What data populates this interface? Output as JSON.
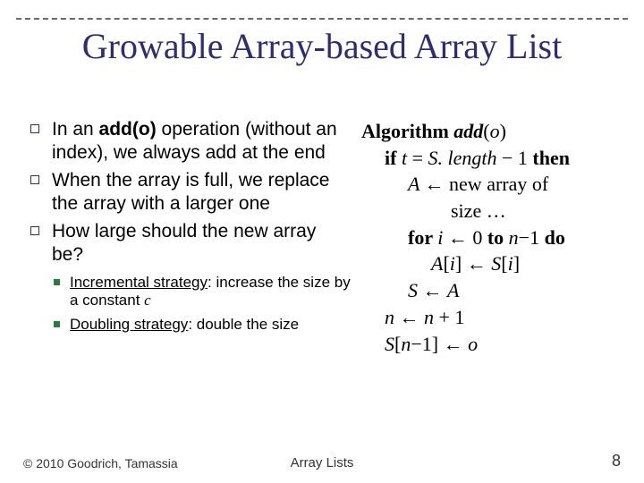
{
  "title": "Growable Array-based Array List",
  "bullets": {
    "b1_pre": "In an ",
    "b1_bold": "add(o)",
    "b1_post": " operation (without an index), we always add at the end",
    "b2": "When the array is full, we replace the array with a larger one",
    "b3": "How large should the new array be?",
    "s1_pre": "Incremental strategy",
    "s1_post": ": increase the size by a constant ",
    "s1_c": "c",
    "s2_pre": "Doubling strategy",
    "s2_post": ": double the size"
  },
  "algo": {
    "l0_kw": "Algorithm ",
    "l0_name_a": "add",
    "l0_name_b": "(",
    "l0_name_c": "o",
    "l0_name_d": ")",
    "l1_if": "if ",
    "l1_t": "t ",
    "l1_eq": "= ",
    "l1_S": "S. length ",
    "l1_minus": "− 1 ",
    "l1_then": "then",
    "l2_A": "A ",
    "l2_arr": "← new array of",
    "l3": "size …",
    "l4_for": "for ",
    "l4_i": "i ",
    "l4_a1": "← 0 ",
    "l4_to": "to ",
    "l4_n": "n",
    "l4_m1": "−1 ",
    "l4_do": "do",
    "l5_Ai": "A",
    "l5_lb": "[",
    "l5_i": "i",
    "l5_rb": "] ",
    "l5_arr": "← ",
    "l5_Si": "S",
    "l5_lb2": "[",
    "l5_i2": "i",
    "l5_rb2": "]",
    "l6_S": "S ",
    "l6_arr": "← ",
    "l6_A": "A",
    "l7_n": "n ",
    "l7_arr": "← ",
    "l7_n2": "n ",
    "l7_p1": "+ 1",
    "l8_S": "S",
    "l8_lb": "[",
    "l8_n": "n",
    "l8_m1": "−1] ",
    "l8_arr": "← ",
    "l8_o": "o"
  },
  "footer": {
    "left": "© 2010 Goodrich, Tamassia",
    "center": "Array Lists",
    "right": "8"
  }
}
